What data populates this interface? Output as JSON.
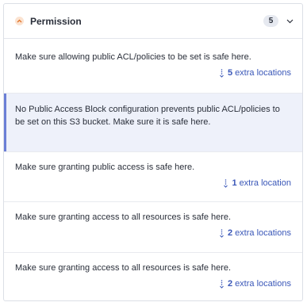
{
  "header": {
    "title": "Permission",
    "count": "5",
    "severity_icon": "chevron-up-orange-icon",
    "expand_icon": "chevron-down-icon",
    "accent_color": "#e2762c"
  },
  "issues": [
    {
      "message": "Make sure allowing public ACL/policies to be set is safe here.",
      "locations_count": "5",
      "locations_label": "extra locations"
    },
    {
      "message": "No Public Access Block configuration prevents public ACL/policies to be set on this S3 bucket. Make sure it is safe here.",
      "selected": true
    },
    {
      "message": "Make sure granting public access is safe here.",
      "locations_count": "1",
      "locations_label": "extra location"
    },
    {
      "message": "Make sure granting access to all resources is safe here.",
      "locations_count": "2",
      "locations_label": "extra locations"
    },
    {
      "message": "Make sure granting access to all resources is safe here.",
      "locations_count": "2",
      "locations_label": "extra locations"
    }
  ]
}
